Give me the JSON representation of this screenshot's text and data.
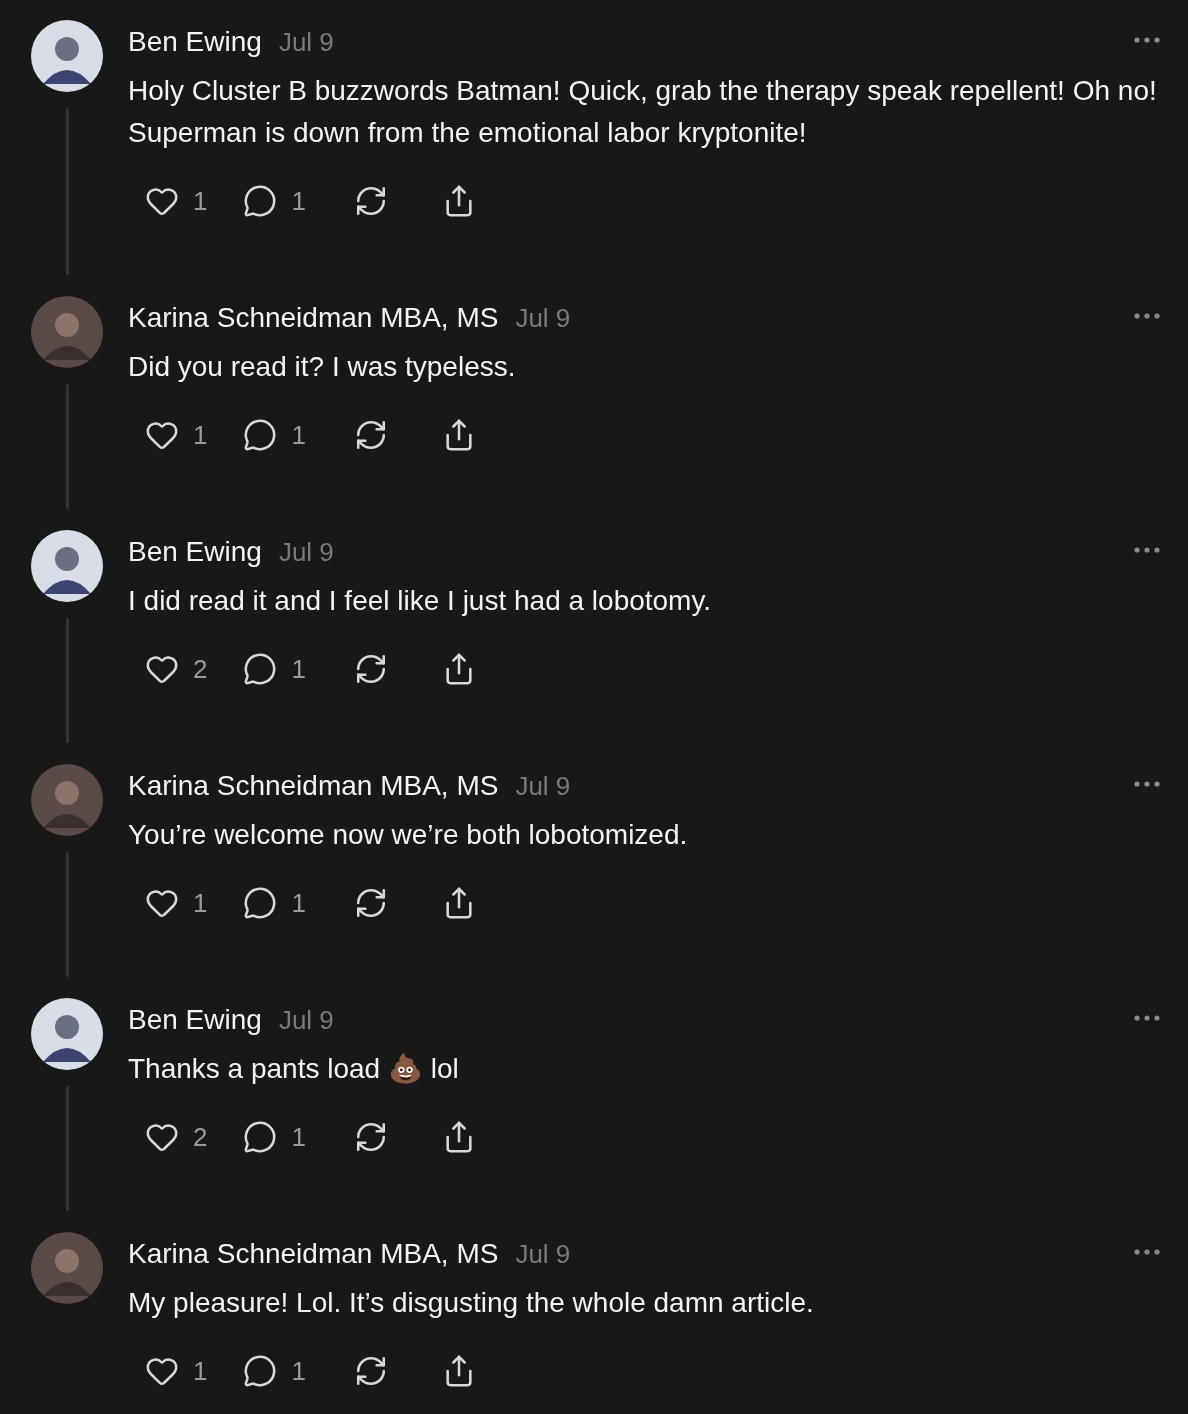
{
  "posts": [
    {
      "author": "Ben Ewing",
      "date": "Jul 9",
      "text": "Holy Cluster B buzzwords Batman! Quick, grab the therapy speak repellent! Oh no! Superman is down from the emotional labor kryptonite!",
      "likes": "1",
      "replies": "1",
      "thread_line": true
    },
    {
      "author": "Karina Schneidman MBA, MS",
      "date": "Jul 9",
      "text": "Did you read it? I was typeless.",
      "likes": "1",
      "replies": "1",
      "thread_line": true
    },
    {
      "author": "Ben Ewing",
      "date": "Jul 9",
      "text": "I did read it and I feel like I just had a lobotomy.",
      "likes": "2",
      "replies": "1",
      "thread_line": true
    },
    {
      "author": "Karina Schneidman MBA, MS",
      "date": "Jul 9",
      "text": "You’re welcome now we’re both lobotomized.",
      "likes": "1",
      "replies": "1",
      "thread_line": true
    },
    {
      "author": "Ben Ewing",
      "date": "Jul 9",
      "text": "Thanks a pants load 💩 lol",
      "likes": "2",
      "replies": "1",
      "thread_line": true
    },
    {
      "author": "Karina Schneidman MBA, MS",
      "date": "Jul 9",
      "text": "My pleasure! Lol. It’s disgusting the whole damn article.",
      "likes": "1",
      "replies": "1",
      "thread_line": false
    }
  ]
}
